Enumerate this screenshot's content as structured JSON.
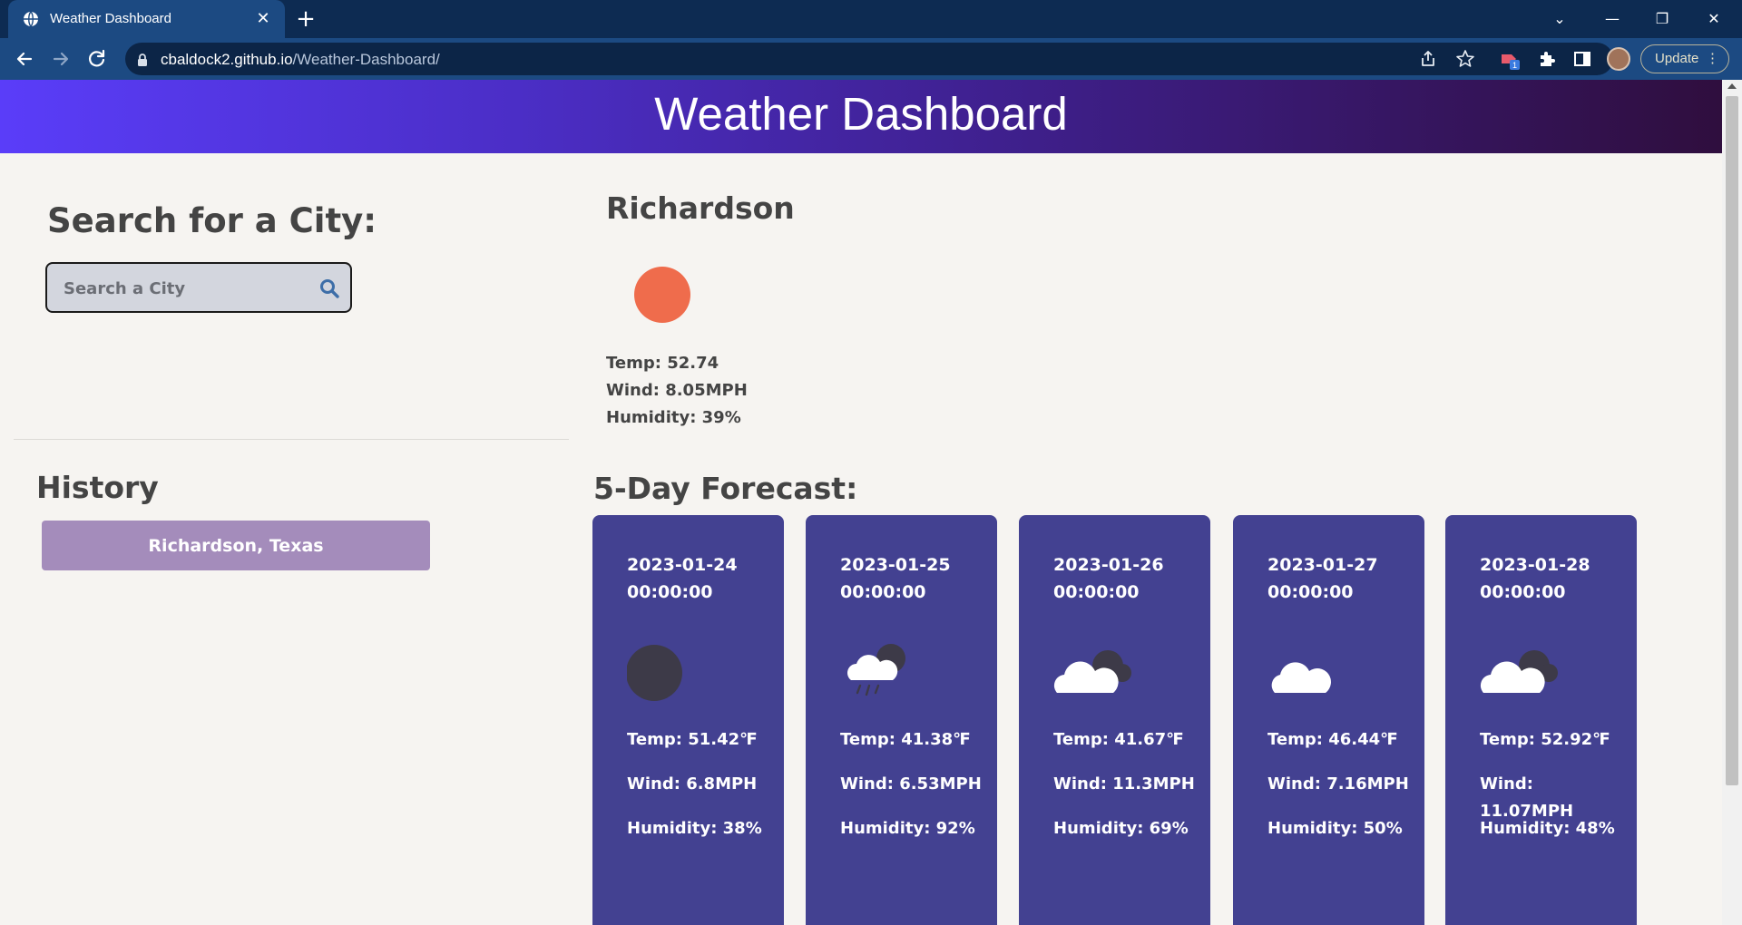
{
  "browser": {
    "tab_title": "Weather Dashboard",
    "url_host": "cbaldock2.github.io",
    "url_path": "/Weather-Dashboard/",
    "update_label": "Update",
    "extension_badge": "1"
  },
  "header": {
    "title": "Weather Dashboard"
  },
  "search": {
    "title": "Search for a City:",
    "placeholder": "Search a City"
  },
  "history": {
    "title": "History",
    "items": [
      "Richardson, Texas"
    ]
  },
  "current": {
    "city": "Richardson",
    "icon": "sun-icon",
    "icon_color": "#ef6c4c",
    "temp": "Temp: 52.74",
    "wind": "Wind: 8.05MPH",
    "humidity": "Humidity: 39%"
  },
  "forecast": {
    "title": "5-Day Forecast:",
    "card_color": "#434191",
    "days": [
      {
        "date": "2023-01-24 00:00:00",
        "icon": "moon-icon",
        "temp": "Temp: 51.42℉",
        "wind": "Wind: 6.8MPH",
        "humidity": "Humidity: 38%"
      },
      {
        "date": "2023-01-25 00:00:00",
        "icon": "rain-cloud-moon-icon",
        "temp": "Temp: 41.38℉",
        "wind": "Wind: 6.53MPH",
        "humidity": "Humidity: 92%"
      },
      {
        "date": "2023-01-26 00:00:00",
        "icon": "cloud-moon-icon",
        "temp": "Temp: 41.67℉",
        "wind": "Wind: 11.3MPH",
        "humidity": "Humidity: 69%"
      },
      {
        "date": "2023-01-27 00:00:00",
        "icon": "cloud-icon",
        "temp": "Temp: 46.44℉",
        "wind": "Wind: 7.16MPH",
        "humidity": "Humidity: 50%"
      },
      {
        "date": "2023-01-28 00:00:00",
        "icon": "cloud-moon-icon",
        "temp": "Temp: 52.92℉",
        "wind": "Wind: 11.07MPH",
        "humidity": "Humidity: 48%"
      }
    ]
  }
}
